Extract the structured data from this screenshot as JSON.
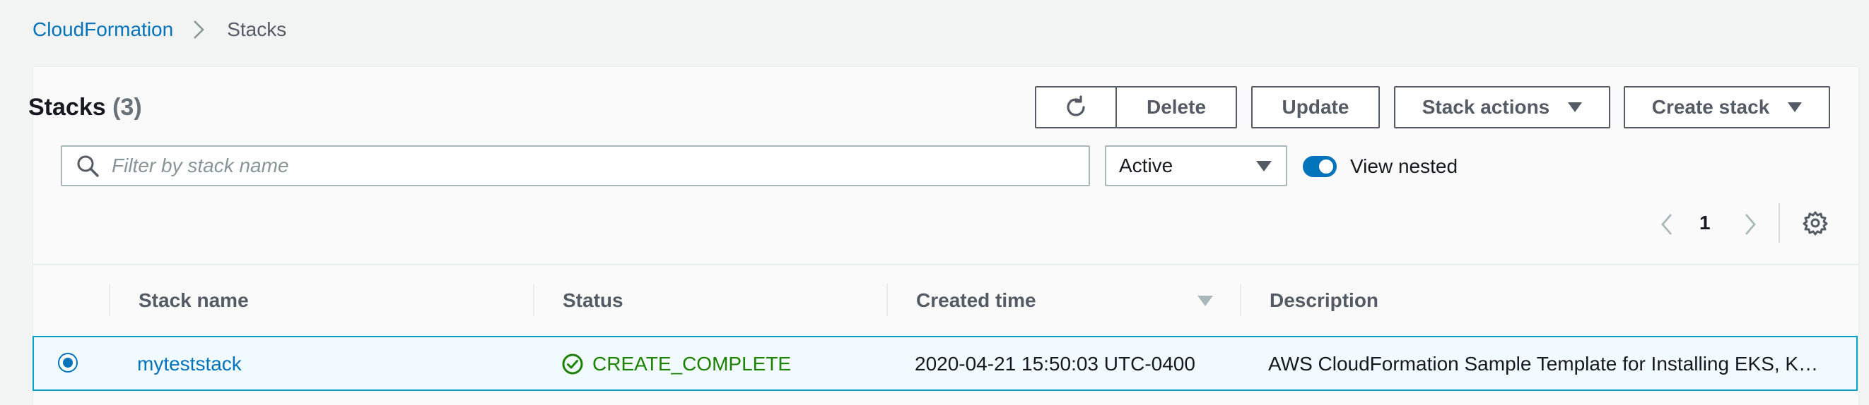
{
  "breadcrumb": {
    "parent": "CloudFormation",
    "current": "Stacks",
    "separator_icon": "chevron-right-icon"
  },
  "panel": {
    "title": "Stacks",
    "count": "(3)"
  },
  "toolbar": {
    "refresh_icon": "refresh-icon",
    "delete_label": "Delete",
    "update_label": "Update",
    "stack_actions_label": "Stack actions",
    "create_stack_label": "Create stack"
  },
  "filter": {
    "search_placeholder": "Filter by stack name",
    "search_value": "",
    "status_selected": "Active",
    "view_nested_label": "View nested",
    "view_nested_on": true
  },
  "pagination": {
    "current_page": "1",
    "prev_icon": "chevron-left-icon",
    "next_icon": "chevron-right-icon",
    "settings_icon": "gear-icon"
  },
  "table": {
    "columns": [
      "Stack name",
      "Status",
      "Created time",
      "Description"
    ],
    "sorted_column": "Created time",
    "sort_direction": "descending",
    "rows": [
      {
        "selected": true,
        "name": "myteststack",
        "status": "CREATE_COMPLETE",
        "created": "2020-04-21 15:50:03 UTC-0400",
        "description": "AWS CloudFormation Sample Template for Installing EKS, K…"
      }
    ]
  },
  "colors": {
    "link": "#0073bb",
    "success": "#1d8102",
    "selected_row_bg": "#f1faff",
    "selected_row_border": "#00a1c9",
    "toggle_on": "#0073bb"
  }
}
